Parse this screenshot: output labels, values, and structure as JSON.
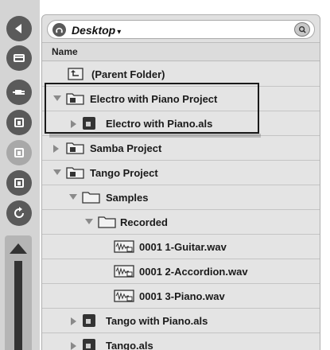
{
  "sidebar": {
    "buttons": [
      {
        "name": "back-icon"
      },
      {
        "name": "browser-icon"
      },
      {
        "name": "plugin-icon"
      },
      {
        "name": "place-1-icon"
      },
      {
        "name": "place-2-icon"
      },
      {
        "name": "place-3-icon"
      },
      {
        "name": "refresh-icon"
      }
    ]
  },
  "browser": {
    "location": "Desktop",
    "location_caret": "▾",
    "column_header": "Name",
    "rows": [
      {
        "label": "(Parent Folder)"
      },
      {
        "label": "Electro with Piano Project"
      },
      {
        "label": "Electro with Piano.als"
      },
      {
        "label": "Samba Project"
      },
      {
        "label": "Tango Project"
      },
      {
        "label": "Samples"
      },
      {
        "label": "Recorded"
      },
      {
        "label": "0001 1-Guitar.wav"
      },
      {
        "label": "0001 2-Accordion.wav"
      },
      {
        "label": "0001 3-Piano.wav"
      },
      {
        "label": "Tango with Piano.als"
      },
      {
        "label": "Tango.als"
      }
    ]
  }
}
